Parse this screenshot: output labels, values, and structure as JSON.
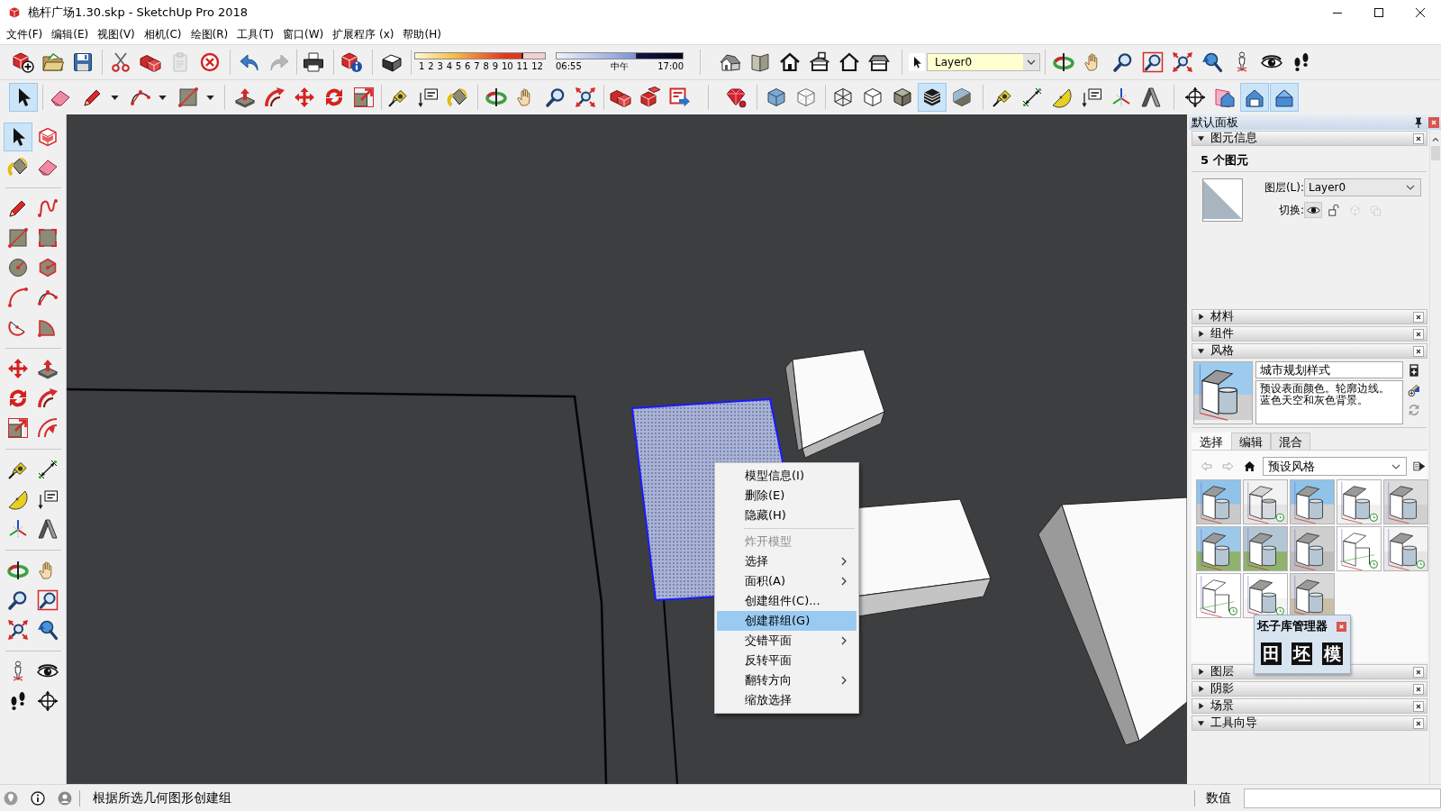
{
  "window": {
    "title": "桅杆广场1.30.skp - SketchUp Pro 2018"
  },
  "menu_bar": [
    {
      "label": "文件(F)"
    },
    {
      "label": "编辑(E)"
    },
    {
      "label": "视图(V)"
    },
    {
      "label": "相机(C)"
    },
    {
      "label": "绘图(R)"
    },
    {
      "label": "工具(T)"
    },
    {
      "label": "窗口(W)"
    },
    {
      "label": "扩展程序 (x)"
    },
    {
      "label": "帮助(H)"
    }
  ],
  "toolbar_1": [
    {
      "kind": "buttons",
      "buttons": [
        {
          "disabled": false
        },
        {
          "disabled": false
        },
        {
          "disabled": false
        }
      ]
    },
    {
      "kind": "buttons",
      "buttons": [
        {
          "disabled": false
        },
        {
          "disabled": false
        },
        {
          "disabled": true
        },
        {
          "disabled": false
        }
      ]
    },
    {
      "kind": "buttons",
      "buttons": [
        {
          "disabled": false
        },
        {
          "disabled": true
        }
      ]
    },
    {
      "kind": "buttons",
      "buttons": [
        {
          "disabled": false
        }
      ]
    },
    {
      "kind": "buttons",
      "buttons": [
        {
          "disabled": false
        }
      ]
    },
    {
      "kind": "buttons",
      "buttons": [
        {
          "disabled": false
        }
      ]
    },
    {
      "kind": "sliders",
      "sliders": [
        {
          "kind": "month",
          "labels": [
            "1",
            "2",
            "3",
            "4",
            "5",
            "6",
            "7",
            "8",
            "9",
            "10",
            "11",
            "12"
          ],
          "level": 0.83
        },
        {
          "kind": "time",
          "labels": [
            "06:55",
            "中午",
            "17:00"
          ],
          "level": 0.64
        }
      ]
    },
    {
      "kind": "buttons",
      "buttons": [
        {
          "disabled": false
        },
        {
          "disabled": false
        },
        {
          "disabled": false
        },
        {
          "disabled": false
        },
        {
          "disabled": false
        },
        {
          "disabled": false
        }
      ]
    },
    {
      "kind": "layer_select",
      "value": "Layer0"
    },
    {
      "kind": "buttons",
      "buttons": [
        {
          "disabled": false
        },
        {
          "disabled": false
        },
        {
          "disabled": false
        },
        {
          "disabled": false
        },
        {
          "disabled": false
        },
        {
          "disabled": false
        },
        {
          "disabled": false
        },
        {
          "disabled": false
        },
        {
          "disabled": false
        }
      ]
    }
  ],
  "toolbar_2": [
    {
      "buttons": [
        {
          "selected": true
        }
      ]
    },
    {
      "buttons": [
        {
          "selected": false
        },
        {
          "selected": false
        },
        {
          "selected": false
        },
        {
          "selected": false
        }
      ]
    },
    {
      "buttons": [
        {
          "selected": false
        },
        {
          "selected": false
        },
        {
          "selected": false
        },
        {
          "selected": false
        },
        {
          "selected": false
        }
      ]
    },
    {
      "buttons": [
        {
          "selected": false
        },
        {
          "selected": false
        },
        {
          "selected": false
        }
      ]
    },
    {
      "buttons": [
        {
          "selected": false
        },
        {
          "selected": false
        },
        {
          "selected": false
        },
        {
          "selected": false
        }
      ]
    },
    {
      "buttons": [
        {
          "selected": false
        },
        {
          "selected": false
        },
        {
          "selected": false
        }
      ]
    },
    {
      "buttons": [
        {
          "selected": false
        }
      ]
    },
    {
      "buttons": [
        {
          "selected": false
        },
        {
          "selected": false
        }
      ]
    },
    {
      "buttons": [
        {
          "selected": false
        },
        {
          "selected": false
        },
        {
          "selected": false
        },
        {
          "selected": true
        },
        {
          "selected": false
        }
      ]
    },
    {
      "buttons": [
        {
          "selected": false
        },
        {
          "selected": false
        },
        {
          "selected": false
        },
        {
          "selected": false
        },
        {
          "selected": false
        },
        {
          "selected": false
        }
      ]
    },
    {
      "buttons": [
        {
          "selected": false
        },
        {
          "selected": false
        },
        {
          "selected": true
        },
        {
          "selected": true
        }
      ]
    }
  ],
  "tool_palette": [
    {
      "buttons": [
        {
          "selected": true
        },
        {
          "selected": false
        },
        {
          "selected": false
        },
        {
          "selected": false
        }
      ]
    },
    {
      "buttons": [
        {
          "selected": false
        },
        {
          "selected": false
        },
        {
          "selected": false
        },
        {
          "selected": false
        },
        {
          "selected": false
        },
        {
          "selected": false
        },
        {
          "selected": false
        },
        {
          "selected": false
        },
        {
          "selected": false
        },
        {
          "selected": false
        }
      ]
    },
    {
      "buttons": [
        {
          "selected": false
        },
        {
          "selected": false
        },
        {
          "selected": false
        },
        {
          "selected": false
        },
        {
          "selected": false
        },
        {
          "selected": false
        }
      ]
    },
    {
      "buttons": [
        {
          "selected": false
        },
        {
          "selected": false
        },
        {
          "selected": false
        },
        {
          "selected": false
        },
        {
          "selected": false
        },
        {
          "selected": false
        }
      ]
    },
    {
      "buttons": [
        {
          "selected": false
        },
        {
          "selected": false
        },
        {
          "selected": false
        },
        {
          "selected": false
        },
        {
          "selected": false
        },
        {
          "selected": false
        }
      ]
    },
    {
      "buttons": [
        {
          "selected": false
        },
        {
          "selected": false
        },
        {
          "selected": false
        },
        {
          "selected": false
        }
      ]
    }
  ],
  "viewport": {
    "context_menu": {
      "items": [
        {
          "kind": "item",
          "label": "模型信息(I)",
          "selected": false,
          "disabled": false,
          "submenu": false
        },
        {
          "kind": "item",
          "label": "删除(E)",
          "selected": false,
          "disabled": false,
          "submenu": false
        },
        {
          "kind": "item",
          "label": "隐藏(H)",
          "selected": false,
          "disabled": false,
          "submenu": false
        },
        {
          "kind": "separator"
        },
        {
          "kind": "item",
          "label": "炸开模型",
          "selected": false,
          "disabled": true,
          "submenu": false
        },
        {
          "kind": "item",
          "label": "选择",
          "selected": false,
          "disabled": false,
          "submenu": true
        },
        {
          "kind": "item",
          "label": "面积(A)",
          "selected": false,
          "disabled": false,
          "submenu": true
        },
        {
          "kind": "item",
          "label": "创建组件(C)...",
          "selected": false,
          "disabled": false,
          "submenu": false
        },
        {
          "kind": "item",
          "label": "创建群组(G)",
          "selected": true,
          "disabled": false,
          "submenu": false
        },
        {
          "kind": "item",
          "label": "交错平面",
          "selected": false,
          "disabled": false,
          "submenu": true
        },
        {
          "kind": "item",
          "label": "反转平面",
          "selected": false,
          "disabled": false,
          "submenu": false
        },
        {
          "kind": "item",
          "label": "翻转方向",
          "selected": false,
          "disabled": false,
          "submenu": true
        },
        {
          "kind": "item",
          "label": "缩放选择",
          "selected": false,
          "disabled": false,
          "submenu": false
        }
      ]
    }
  },
  "tray": {
    "title": "默认面板",
    "sections": [
      {
        "kind": "entity_info",
        "title": "图元信息",
        "expanded": true,
        "count": "5 个图元",
        "layer_label": "图层(L):",
        "layer_value": "Layer0",
        "toggle_label": "切换:",
        "toggles": [
          {
            "selected": true,
            "disabled": false
          },
          {
            "selected": false,
            "disabled": false
          },
          {
            "selected": false,
            "disabled": true
          },
          {
            "selected": false,
            "disabled": true
          }
        ]
      },
      {
        "kind": "plain",
        "title": "材料",
        "expanded": false
      },
      {
        "kind": "plain",
        "title": "组件",
        "expanded": false
      },
      {
        "kind": "styles",
        "title": "风格",
        "expanded": true,
        "style_name": "城市规划样式",
        "description": "预设表面颜色。轮廓边线。蓝色天空和灰色背景。",
        "tabs": [
          {
            "label": "选择",
            "selected": true
          },
          {
            "label": "编辑",
            "selected": false
          },
          {
            "label": "混合",
            "selected": false
          }
        ],
        "collection": "预设风格"
      },
      {
        "kind": "plain",
        "title": "图层",
        "expanded": false
      },
      {
        "kind": "plain",
        "title": "阴影",
        "expanded": false
      },
      {
        "kind": "plain",
        "title": "场景",
        "expanded": false
      },
      {
        "kind": "plain",
        "title": "工具向导",
        "expanded": true
      }
    ]
  },
  "plugin_window": {
    "title": "坯子库管理器",
    "buttons": [
      {
        "label": "田"
      },
      {
        "label": "坯"
      },
      {
        "label": "模"
      }
    ]
  },
  "status_bar": {
    "message": "根据所选几何图形创建组",
    "measurement_label": "数值"
  }
}
